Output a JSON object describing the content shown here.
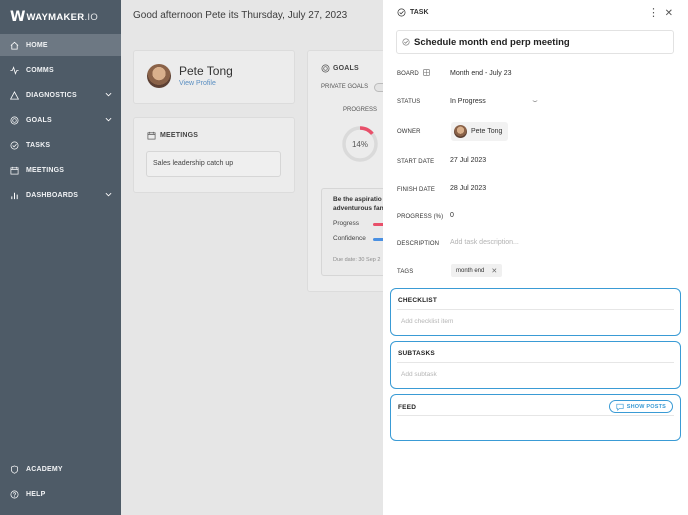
{
  "app": {
    "logo_mark": "W",
    "logo_name": "WAYMAKER",
    "logo_suffix": ".IO"
  },
  "sidebar": {
    "items": [
      {
        "label": "HOME",
        "icon": "home-icon",
        "active": true
      },
      {
        "label": "COMMS",
        "icon": "pulse-icon"
      },
      {
        "label": "DIAGNOSTICS",
        "icon": "triangle-icon",
        "expandable": true
      },
      {
        "label": "GOALS",
        "icon": "target-icon",
        "expandable": true
      },
      {
        "label": "TASKS",
        "icon": "check-circle-icon"
      },
      {
        "label": "MEETINGS",
        "icon": "calendar-icon"
      },
      {
        "label": "DASHBOARDS",
        "icon": "bar-chart-icon",
        "expandable": true
      }
    ],
    "bottom_items": [
      {
        "label": "ACADEMY",
        "icon": "shield-icon"
      },
      {
        "label": "HELP",
        "icon": "help-circle-icon"
      }
    ]
  },
  "dashboard": {
    "greeting": "Good afternoon Pete its Thursday, July 27, 2023",
    "profile": {
      "name": "Pete Tong",
      "link": "View Profile"
    },
    "meetings": {
      "title": "MEETINGS",
      "items": [
        "Sales leadership catch up"
      ]
    },
    "goals": {
      "title": "GOALS",
      "private_label": "PRIVATE GOALS",
      "progress_label": "PROGRESS",
      "progress_value": "14%",
      "progress_fraction": 0.14,
      "goal_desc_line1": "Be the aspiratio",
      "goal_desc_line2": "adventurous fan",
      "progress_row": "Progress",
      "confidence_row": "Confidence",
      "due": "Due date: 30 Sep 2"
    }
  },
  "task": {
    "header": "TASK",
    "title": "Schedule month end perp meeting",
    "fields": {
      "board_label": "BOARD",
      "board_value": "Month end - July 23",
      "status_label": "STATUS",
      "status_value": "In Progress",
      "owner_label": "OWNER",
      "owner_value": "Pete Tong",
      "start_label": "START DATE",
      "start_value": "27 Jul 2023",
      "finish_label": "FINISH DATE",
      "finish_value": "28 Jul 2023",
      "progress_label": "PROGRESS (%)",
      "progress_value": "0",
      "description_label": "DESCRIPTION",
      "description_placeholder": "Add task description...",
      "tags_label": "TAGS",
      "tag": "month end"
    },
    "checklist": {
      "title": "CHECKLIST",
      "placeholder": "Add checklist item"
    },
    "subtasks": {
      "title": "SUBTASKS",
      "placeholder": "Add subtask"
    },
    "feed": {
      "title": "FEED",
      "show_posts": "SHOW POSTS"
    }
  },
  "colors": {
    "sidebar": "#4e5b67",
    "sidebar_active": "#6d7883",
    "accent": "#3a9bd5",
    "progress_ring": "#e8506a",
    "confidence_bar": "#4a90e2"
  }
}
